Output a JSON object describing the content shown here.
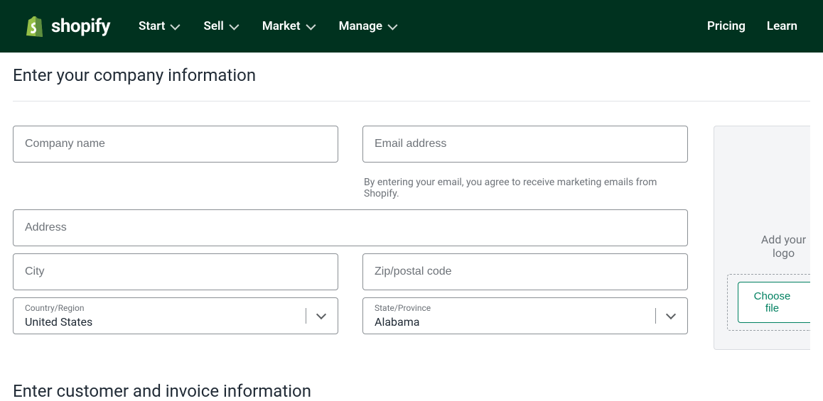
{
  "brand": "shopify",
  "nav": {
    "left": [
      "Start",
      "Sell",
      "Market",
      "Manage"
    ],
    "right": [
      "Pricing",
      "Learn"
    ]
  },
  "sections": {
    "company_title": "Enter your company information",
    "customer_title": "Enter customer and invoice information"
  },
  "fields": {
    "company_name_placeholder": "Company name",
    "email_placeholder": "Email address",
    "email_hint": "By entering your email, you agree to receive marketing emails from Shopify.",
    "address_placeholder": "Address",
    "city_placeholder": "City",
    "zip_placeholder": "Zip/postal code",
    "country_label": "Country/Region",
    "country_value": "United States",
    "state_label": "State/Province",
    "state_value": "Alabama"
  },
  "upload": {
    "title": "Add your logo",
    "button": "Choose file"
  }
}
